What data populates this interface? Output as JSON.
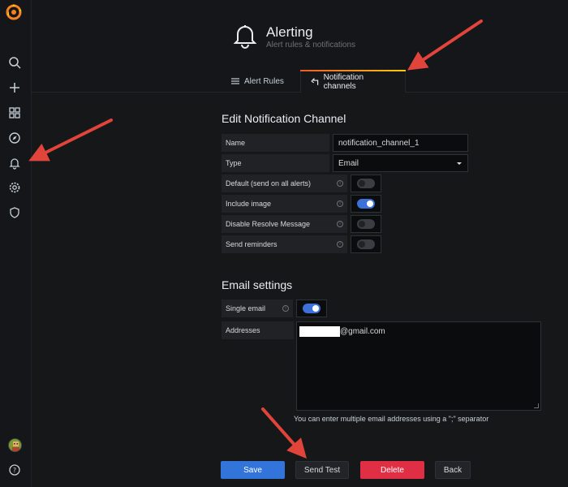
{
  "header": {
    "title": "Alerting",
    "subtitle": "Alert rules & notifications",
    "tabs": [
      {
        "label": "Alert Rules",
        "active": false
      },
      {
        "label": "Notification channels",
        "active": true
      }
    ]
  },
  "form": {
    "title": "Edit Notification Channel",
    "name_label": "Name",
    "name_value": "notification_channel_1",
    "type_label": "Type",
    "type_value": "Email",
    "default_label": "Default (send on all alerts)",
    "default_on": false,
    "include_image_label": "Include image",
    "include_image_on": true,
    "disable_resolve_label": "Disable Resolve Message",
    "disable_resolve_on": false,
    "send_reminders_label": "Send reminders",
    "send_reminders_on": false
  },
  "email": {
    "title": "Email settings",
    "single_email_label": "Single email",
    "single_email_on": true,
    "addresses_label": "Addresses",
    "addresses_value": "@gmail.com",
    "help_text": "You can enter multiple email addresses using a \";\" separator"
  },
  "buttons": {
    "save": "Save",
    "send_test": "Send Test",
    "delete": "Delete",
    "back": "Back"
  },
  "colors": {
    "accent_blue": "#3274d9",
    "danger_red": "#e02f44",
    "annotation_arrow": "#e0443a"
  },
  "icons": [
    "grafana-logo",
    "search-icon",
    "plus-icon",
    "dashboards-icon",
    "compass-icon",
    "bell-icon",
    "gear-icon",
    "shield-icon",
    "avatar",
    "help-icon"
  ]
}
